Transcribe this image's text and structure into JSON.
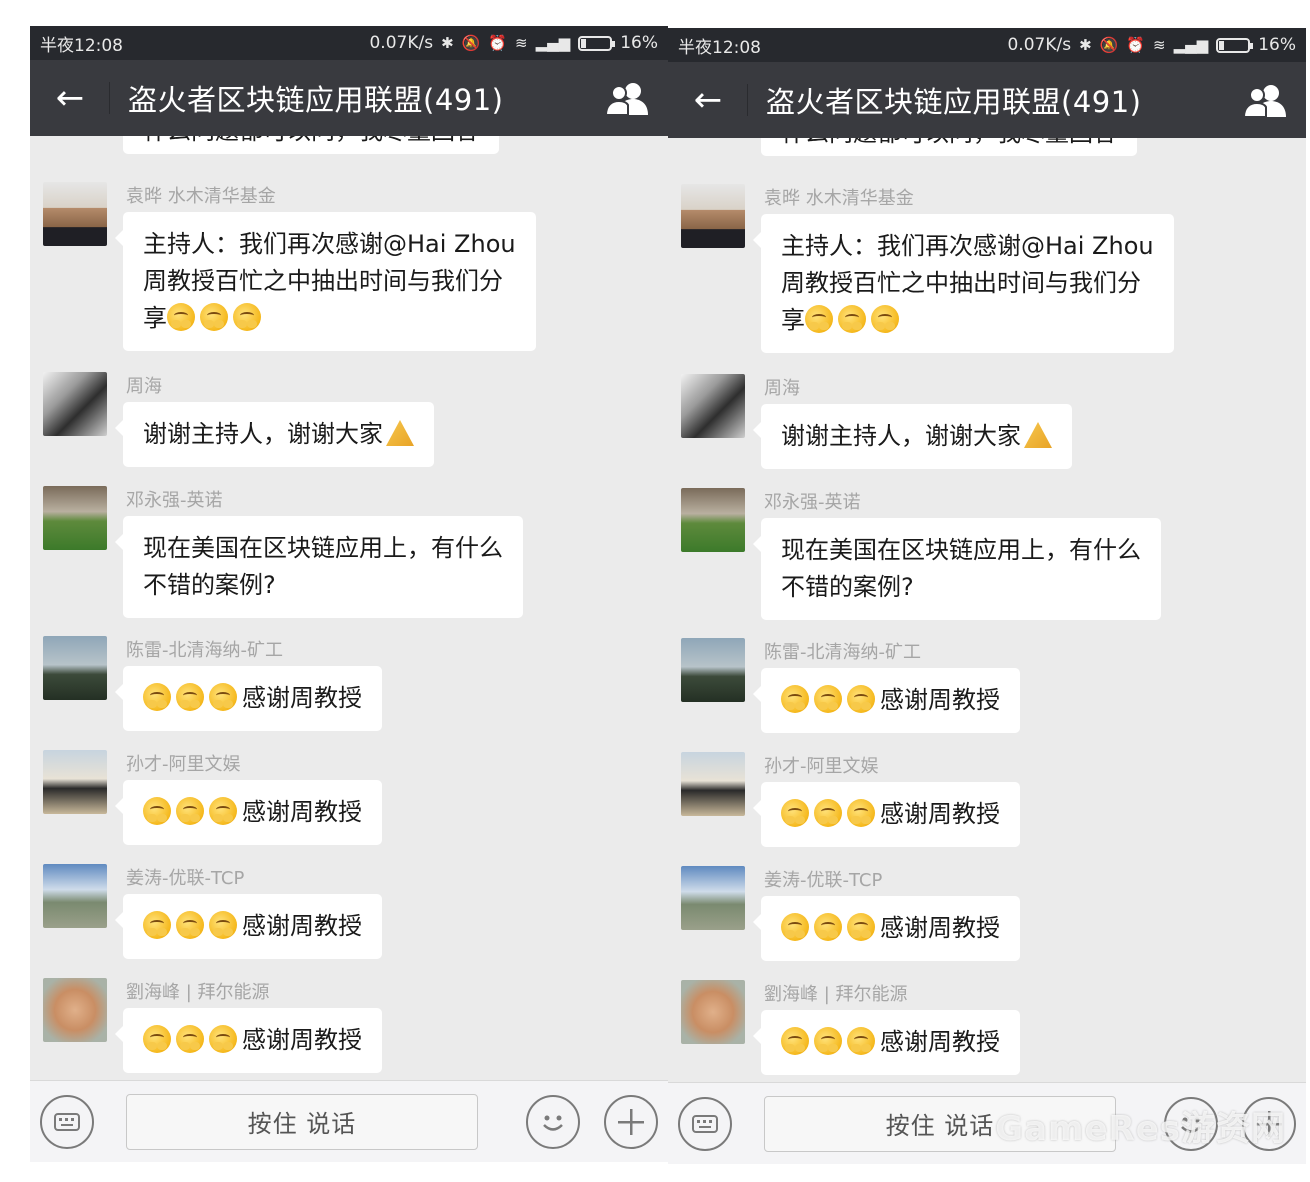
{
  "status_bar": {
    "time": "半夜12:08",
    "net_speed": "0.07K/s",
    "battery": "16%"
  },
  "header": {
    "back_icon": "←",
    "title": "盗火者区块链应用联盟(491)",
    "members_icon": "group-icon"
  },
  "messages": [
    {
      "sender": "",
      "lines": [
        "什么问题都可以问，我尽量回答"
      ],
      "cut": true
    },
    {
      "sender": "袁晔 水木清华基金",
      "lines": [
        "主持人：我们再次感谢@Hai Zhou",
        "周教授百忙之中抽出时间与我们分",
        "享"
      ],
      "emoji_after_last_line": 3,
      "avatar": "av-yuan"
    },
    {
      "sender": "周海",
      "lines": [
        "谢谢主持人，谢谢大家"
      ],
      "hands": true,
      "avatar": "av-zhou"
    },
    {
      "sender": "邓永强-英诺",
      "lines": [
        "现在美国在区块链应用上，有什么",
        "不错的案例?"
      ],
      "avatar": "av-deng"
    },
    {
      "sender": "陈雷-北清海纳-矿工",
      "lines": [
        "感谢周教授"
      ],
      "emoji_before": 3,
      "avatar": "av-chen"
    },
    {
      "sender": "孙才-阿里文娱",
      "lines": [
        "感谢周教授"
      ],
      "emoji_before": 3,
      "avatar": "av-sun"
    },
    {
      "sender": "姜涛-优联-TCP",
      "lines": [
        "感谢周教授"
      ],
      "emoji_before": 3,
      "avatar": "av-jiang"
    },
    {
      "sender": "劉海峰 | 拜尔能源",
      "lines": [
        "感谢周教授"
      ],
      "emoji_before": 3,
      "avatar": "av-liu"
    }
  ],
  "input_bar": {
    "keyboard_icon": "keyboard-icon",
    "hold_to_talk": "按住 说话",
    "emoji_icon": "smiley-icon",
    "plus_icon": "plus-icon"
  },
  "watermark": "GameRes游资网",
  "colors": {
    "status_bar_bg": "#27292e",
    "title_bar_bg": "#393a3f",
    "chat_bg": "#ebebeb",
    "bubble_bg": "#ffffff"
  }
}
